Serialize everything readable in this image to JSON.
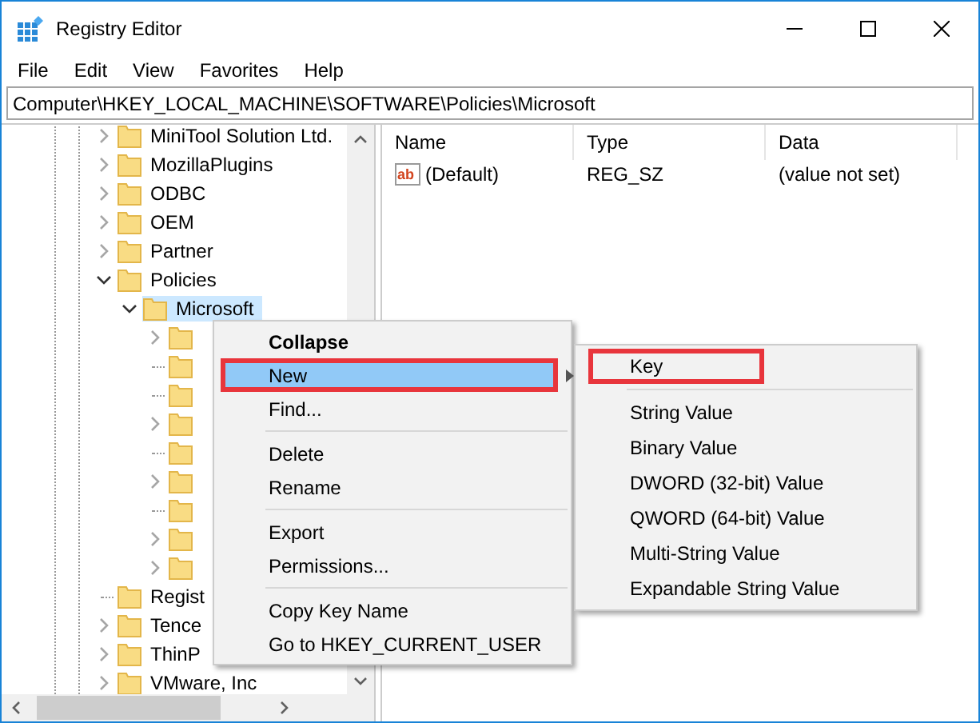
{
  "window": {
    "title": "Registry Editor"
  },
  "menu_bar": [
    "File",
    "Edit",
    "View",
    "Favorites",
    "Help"
  ],
  "address_bar": {
    "value": "Computer\\HKEY_LOCAL_MACHINE\\SOFTWARE\\Policies\\Microsoft"
  },
  "tree": [
    {
      "label": "MiniTool Solution Ltd.",
      "kind": "branch",
      "expanded": false,
      "selected": false
    },
    {
      "label": "MozillaPlugins",
      "kind": "branch",
      "expanded": false,
      "selected": false
    },
    {
      "label": "ODBC",
      "kind": "branch",
      "expanded": false,
      "selected": false
    },
    {
      "label": "OEM",
      "kind": "branch",
      "expanded": false,
      "selected": false
    },
    {
      "label": "Partner",
      "kind": "branch",
      "expanded": false,
      "selected": false
    },
    {
      "label": "Policies",
      "kind": "branch",
      "expanded": true,
      "selected": false,
      "children": [
        {
          "label": "Microsoft",
          "kind": "branch",
          "expanded": true,
          "selected": true,
          "children": [
            {
              "kind": "branch",
              "expanded": false,
              "selected": false
            },
            {
              "kind": "leaf",
              "selected": false
            },
            {
              "kind": "leaf",
              "selected": false
            },
            {
              "kind": "branch",
              "expanded": false,
              "selected": false
            },
            {
              "kind": "leaf",
              "selected": false
            },
            {
              "kind": "branch",
              "expanded": false,
              "selected": false
            },
            {
              "kind": "leaf",
              "selected": false
            },
            {
              "kind": "branch",
              "expanded": false,
              "selected": false
            },
            {
              "kind": "branch",
              "expanded": false,
              "selected": false
            }
          ]
        }
      ]
    },
    {
      "label": "Regist",
      "kind": "leaf",
      "selected": false
    },
    {
      "label": "Tence",
      "kind": "branch",
      "expanded": false,
      "selected": false
    },
    {
      "label": "ThinP",
      "kind": "branch",
      "expanded": false,
      "selected": false
    },
    {
      "label": "VMware, Inc",
      "kind": "branch",
      "expanded": false,
      "selected": false
    }
  ],
  "values_list": {
    "columns": [
      "Name",
      "Type",
      "Data"
    ],
    "rows": [
      {
        "icon_text": "ab",
        "name": "(Default)",
        "type": "REG_SZ",
        "data": "(value not set)"
      }
    ]
  },
  "context_menu": {
    "items": [
      {
        "kind": "item",
        "label": "Collapse",
        "default": true,
        "highlighted": false,
        "submenu": false,
        "annotated": false
      },
      {
        "kind": "item",
        "label": "New",
        "default": false,
        "highlighted": true,
        "submenu": true,
        "annotated": true
      },
      {
        "kind": "item",
        "label": "Find...",
        "default": false,
        "highlighted": false,
        "submenu": false,
        "annotated": false
      },
      {
        "kind": "separator"
      },
      {
        "kind": "item",
        "label": "Delete",
        "default": false,
        "highlighted": false,
        "submenu": false,
        "annotated": false
      },
      {
        "kind": "item",
        "label": "Rename",
        "default": false,
        "highlighted": false,
        "submenu": false,
        "annotated": false
      },
      {
        "kind": "separator"
      },
      {
        "kind": "item",
        "label": "Export",
        "default": false,
        "highlighted": false,
        "submenu": false,
        "annotated": false
      },
      {
        "kind": "item",
        "label": "Permissions...",
        "default": false,
        "highlighted": false,
        "submenu": false,
        "annotated": false
      },
      {
        "kind": "separator"
      },
      {
        "kind": "item",
        "label": "Copy Key Name",
        "default": false,
        "highlighted": false,
        "submenu": false,
        "annotated": false
      },
      {
        "kind": "item",
        "label": "Go to HKEY_CURRENT_USER",
        "default": false,
        "highlighted": false,
        "submenu": false,
        "annotated": false
      }
    ]
  },
  "submenu": {
    "items": [
      {
        "kind": "item",
        "label": "Key",
        "annotated": true
      },
      {
        "kind": "separator"
      },
      {
        "kind": "item",
        "label": "String Value",
        "annotated": false
      },
      {
        "kind": "item",
        "label": "Binary Value",
        "annotated": false
      },
      {
        "kind": "item",
        "label": "DWORD (32-bit) Value",
        "annotated": false
      },
      {
        "kind": "item",
        "label": "QWORD (64-bit) Value",
        "annotated": false
      },
      {
        "kind": "item",
        "label": "Multi-String Value",
        "annotated": false
      },
      {
        "kind": "item",
        "label": "Expandable String Value",
        "annotated": false
      }
    ]
  }
}
